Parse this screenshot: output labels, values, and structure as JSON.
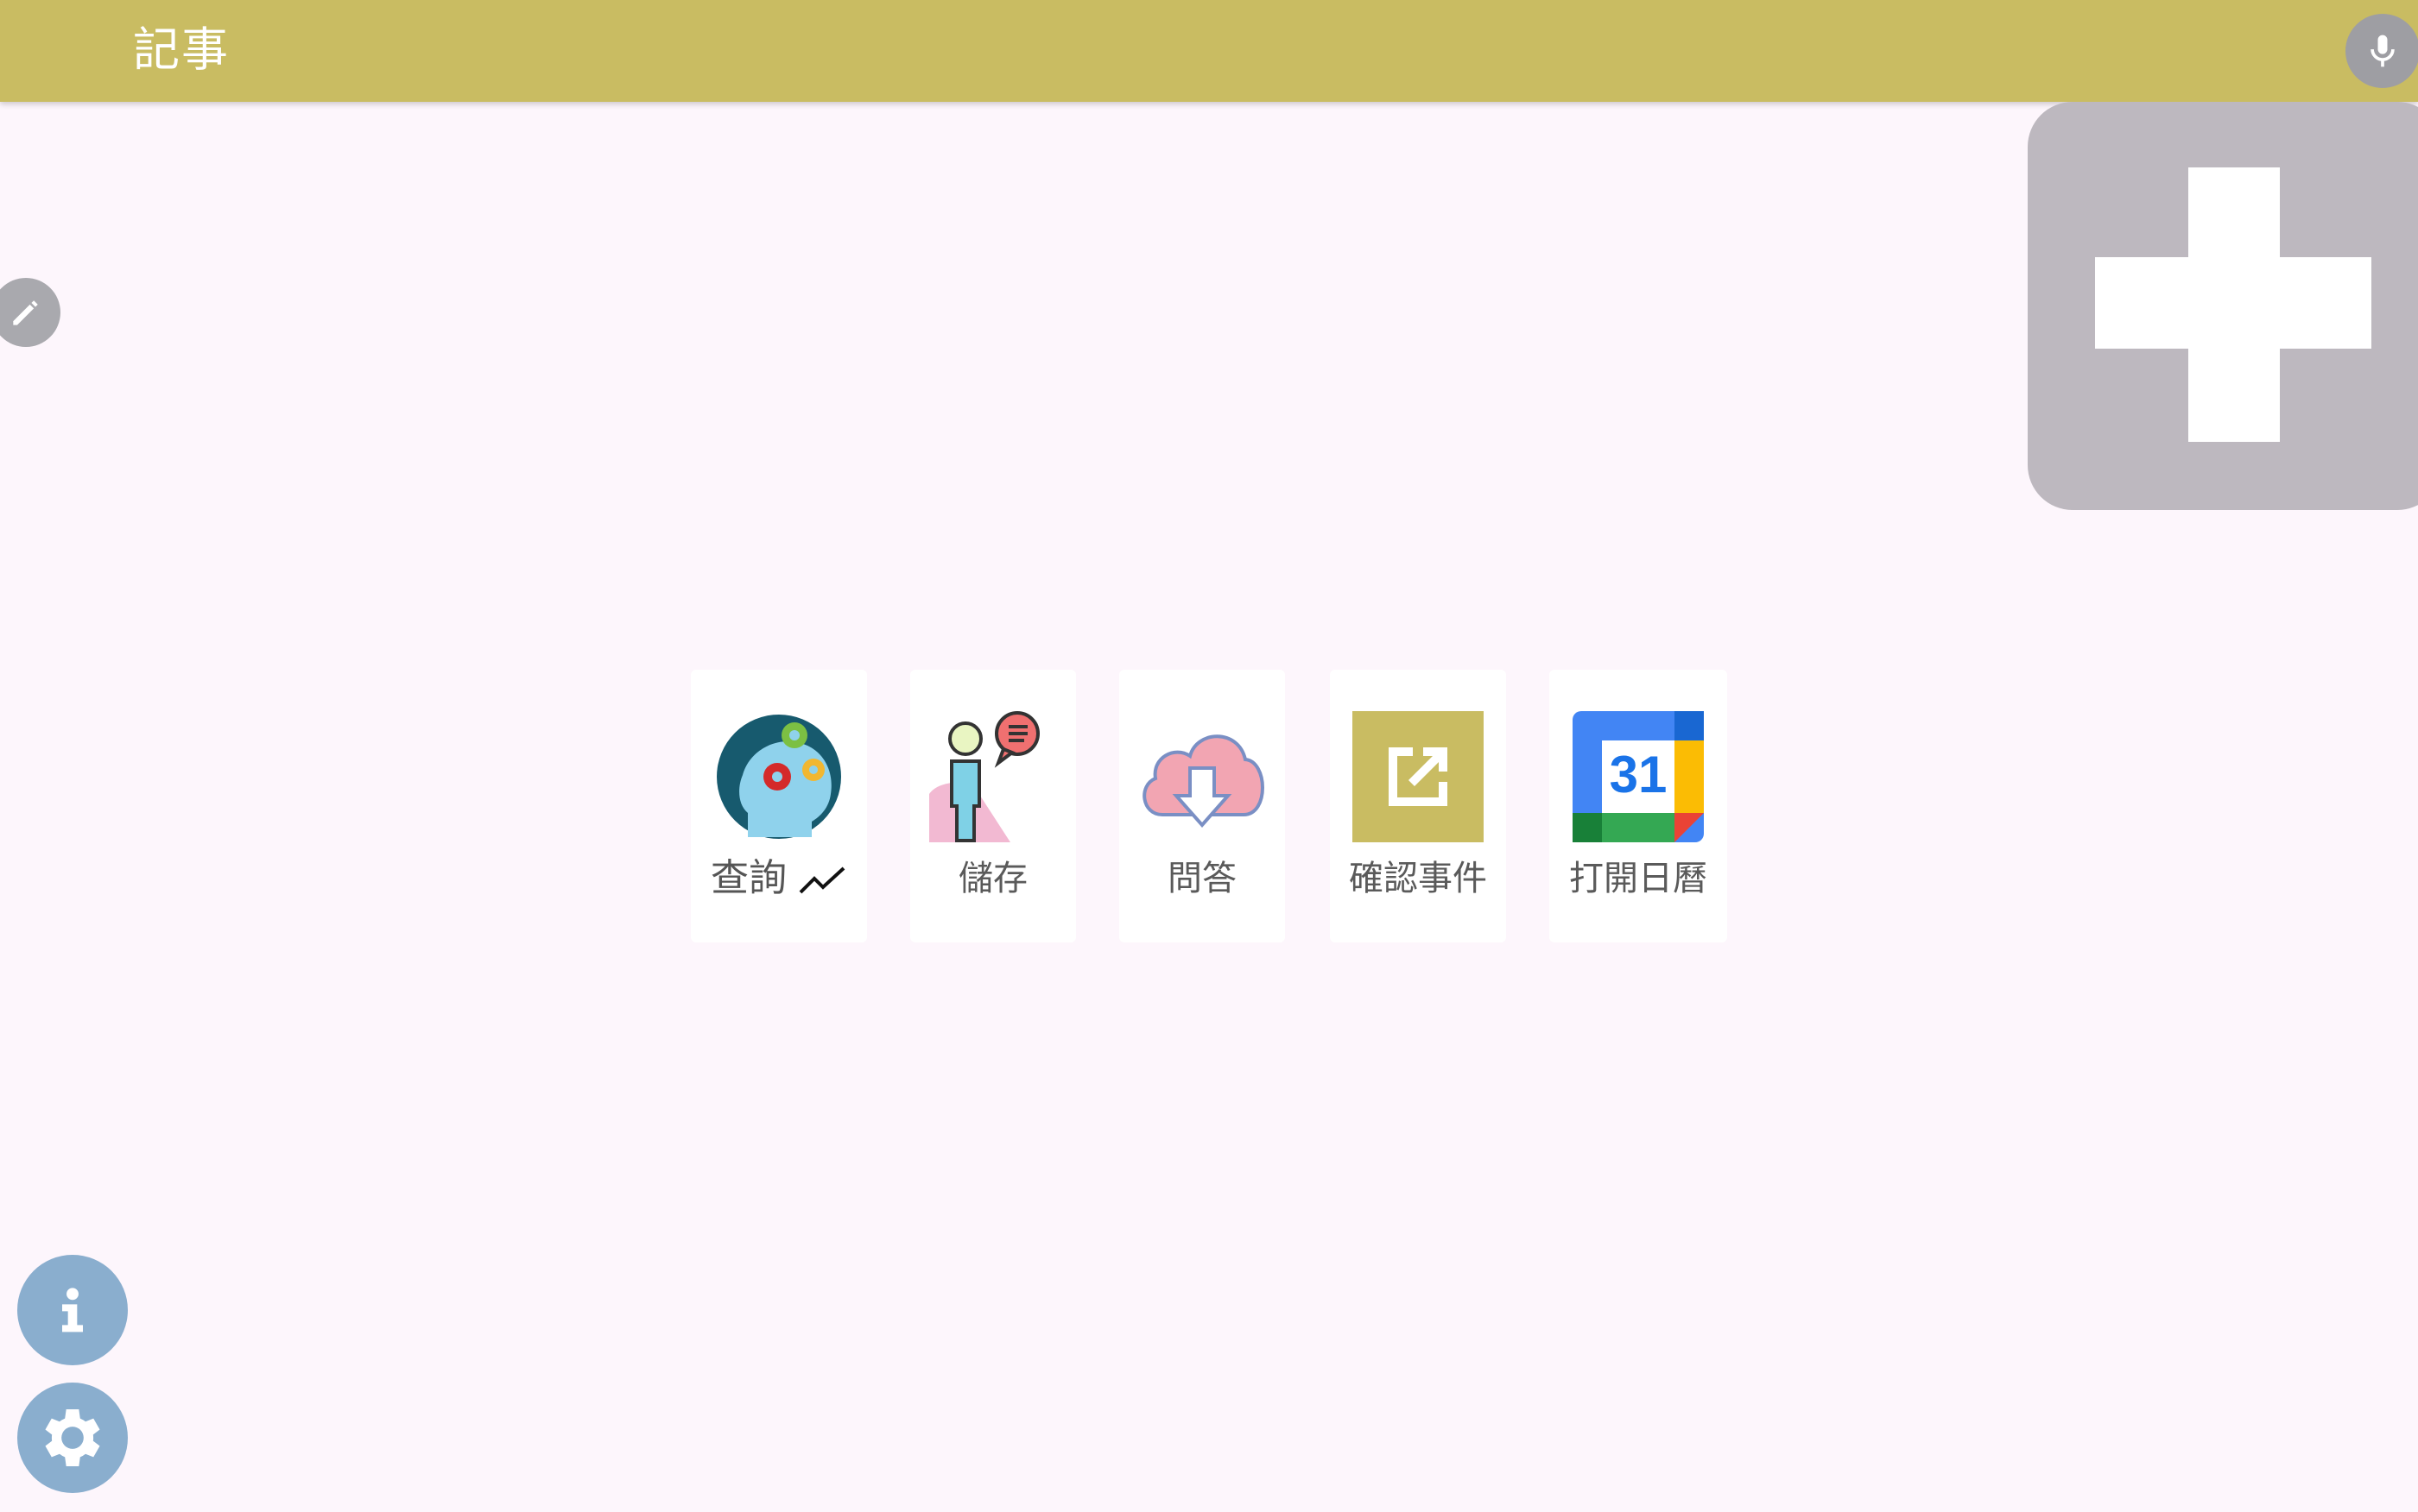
{
  "appbar": {
    "title": "記事"
  },
  "icons": {
    "mic": "mic-icon",
    "add": "plus-icon",
    "edit": "pencil-icon",
    "info": "info-icon",
    "settings": "gear-icon"
  },
  "colors": {
    "appbar": "#c9bc62",
    "background": "#fdf6fc",
    "add_button": "#bdb8bf",
    "round_buttons": "#8aaece",
    "mic_button": "#9e9ea3"
  },
  "shortcuts": [
    {
      "label": "查詢",
      "icon": "brain-gears-icon"
    },
    {
      "label": "儲存",
      "icon": "person-speech-icon"
    },
    {
      "label": "問答",
      "icon": "cloud-download-icon"
    },
    {
      "label": "確認事件",
      "icon": "open-external-icon"
    },
    {
      "label": "打開日曆",
      "icon": "calendar-icon",
      "calendar_day": "31"
    }
  ]
}
